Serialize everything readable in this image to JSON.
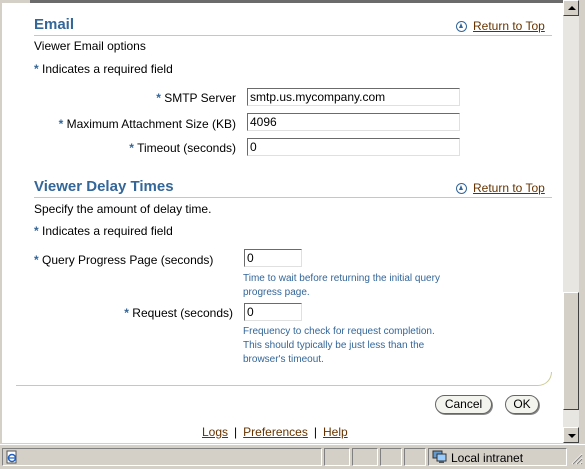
{
  "email": {
    "title": "Email",
    "return_to_top": "Return to Top",
    "description": "Viewer Email options",
    "required_note": "Indicates a required field",
    "required_star": "*",
    "fields": [
      {
        "label": "SMTP Server",
        "value": "smtp.us.mycompany.com"
      },
      {
        "label": "Maximum Attachment Size (KB)",
        "value": "4096"
      },
      {
        "label": "Timeout (seconds)",
        "value": "0"
      }
    ]
  },
  "delay": {
    "title": "Viewer Delay Times",
    "return_to_top": "Return to Top",
    "description": "Specify the amount of delay time.",
    "required_note": "Indicates a required field",
    "fields": [
      {
        "label": "Query Progress Page (seconds)",
        "value": "0",
        "tip_line1": "Time to wait before returning the initial query",
        "tip_line2": "progress page."
      },
      {
        "label": "Request (seconds)",
        "value": "0",
        "tip_line1": "Frequency to check for request completion.",
        "tip_line2": "This should typically be just less than the",
        "tip_line3": "browser's timeout."
      }
    ]
  },
  "buttons": {
    "cancel": "Cancel",
    "ok": "OK"
  },
  "footer": {
    "logs": "Logs",
    "preferences": "Preferences",
    "help": "Help",
    "separator": "|"
  },
  "statusbar": {
    "zone": "Local intranet"
  },
  "colors": {
    "accent": "#336699",
    "link": "#663300",
    "rule": "#cccc99"
  },
  "icons": {
    "return_to_top": "up-arrow-circle-icon",
    "zone": "intranet-computer-icon",
    "page": "ie-page-icon"
  }
}
